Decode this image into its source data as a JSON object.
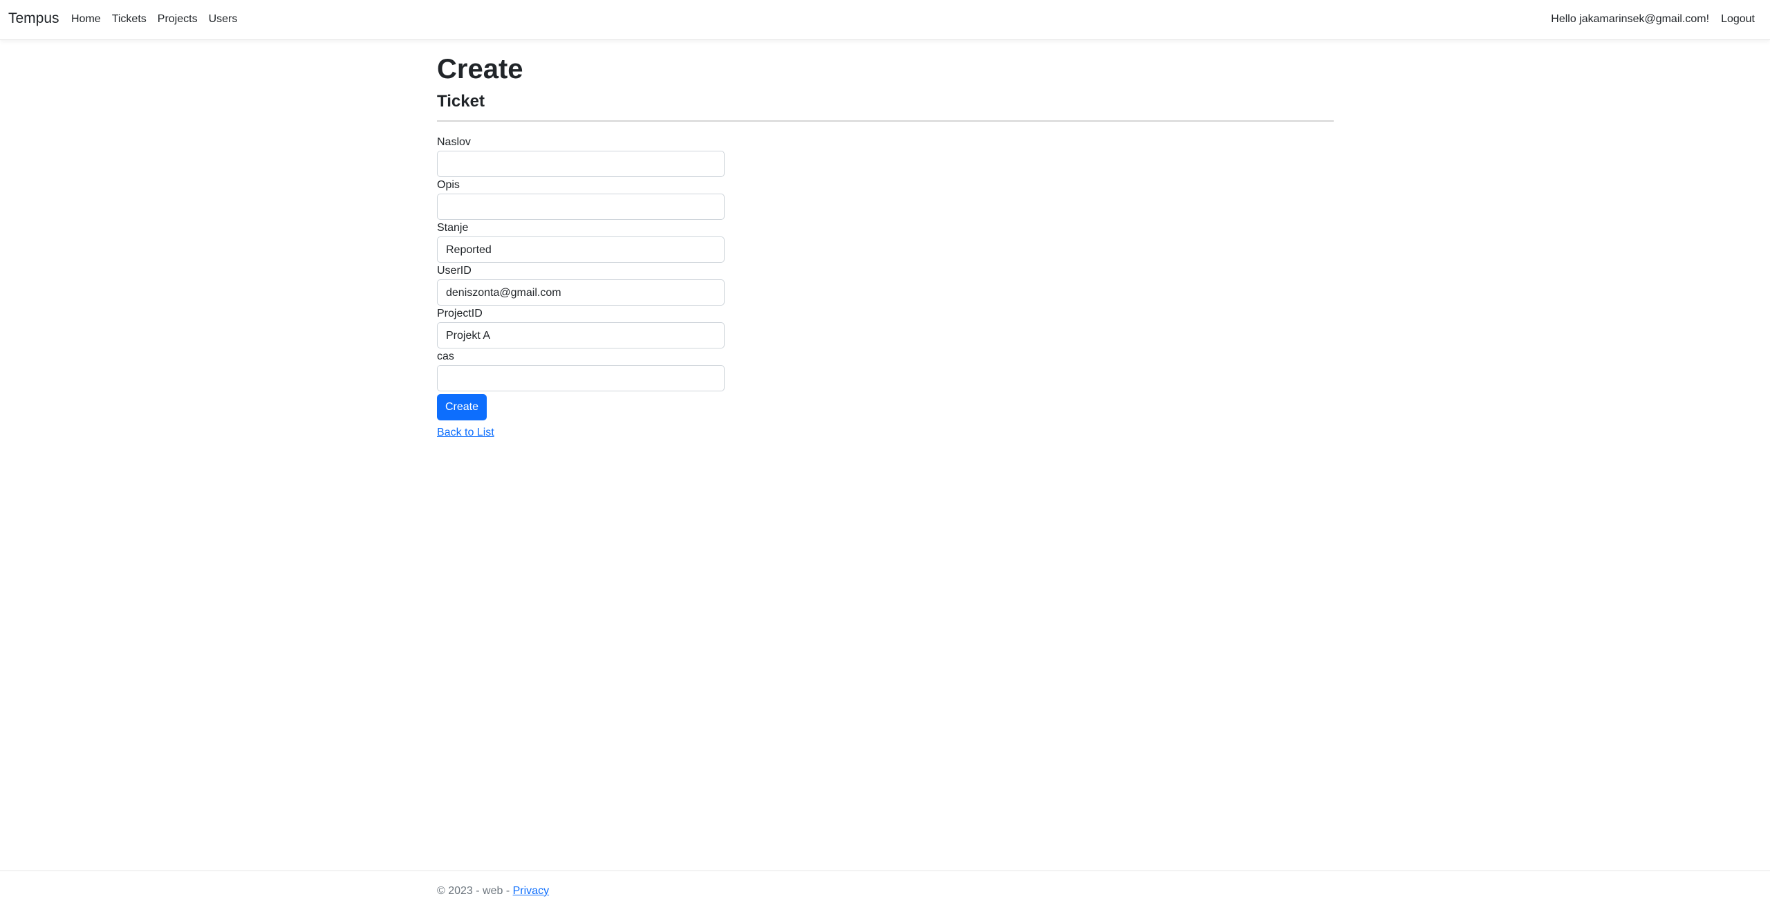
{
  "navbar": {
    "brand": "Tempus",
    "links": [
      {
        "label": "Home"
      },
      {
        "label": "Tickets"
      },
      {
        "label": "Projects"
      },
      {
        "label": "Users"
      }
    ],
    "greeting": "Hello jakamarinsek@gmail.com!",
    "logout": "Logout"
  },
  "page": {
    "title": "Create",
    "subtitle": "Ticket"
  },
  "form": {
    "fields": [
      {
        "label": "Naslov",
        "value": ""
      },
      {
        "label": "Opis",
        "value": ""
      },
      {
        "label": "Stanje",
        "value": "Reported"
      },
      {
        "label": "UserID",
        "value": "deniszonta@gmail.com"
      },
      {
        "label": "ProjectID",
        "value": "Projekt A"
      },
      {
        "label": "cas",
        "value": ""
      }
    ],
    "submit_label": "Create",
    "back_link": "Back to List"
  },
  "footer": {
    "text": "© 2023 - web - ",
    "privacy": "Privacy"
  },
  "colors": {
    "primary": "#0d6efd",
    "text": "#212529",
    "muted": "#6c757d"
  }
}
